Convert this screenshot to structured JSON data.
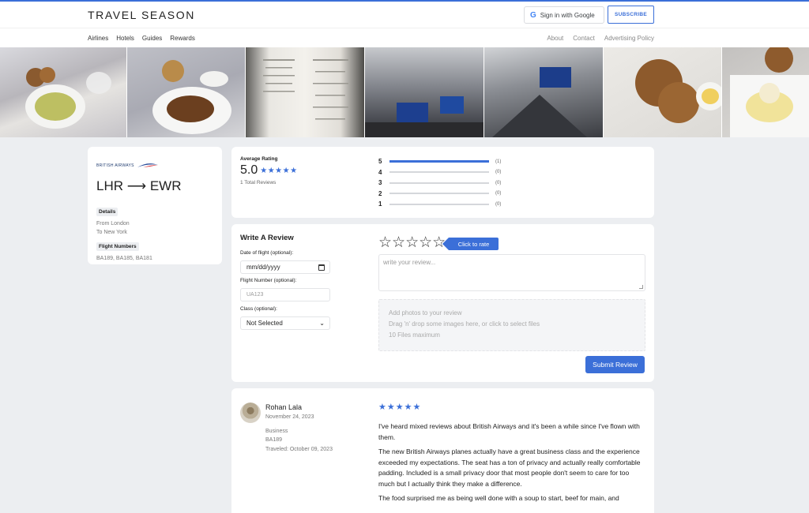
{
  "header": {
    "brand": "TRAVEL SEASON",
    "google_signin": "Sign in with Google",
    "subscribe": "SUBSCRIBE",
    "nav_left": [
      "Airlines",
      "Hotels",
      "Guides",
      "Rewards"
    ],
    "nav_right": [
      "About",
      "Contact",
      "Advertising Policy"
    ]
  },
  "airline": {
    "logo_text": "BRITISH AIRWAYS",
    "route": "LHR ⟶ EWR",
    "details_label": "Details",
    "from": "From London",
    "to": "To New York",
    "flight_numbers_label": "Flight Numbers",
    "flight_numbers": "BA189, BA185, BA181"
  },
  "rating": {
    "label": "Average Rating",
    "value": "5.0",
    "stars": "★★★★★",
    "total": "1 Total Reviews",
    "breakdown": [
      {
        "stars": "5",
        "count": "(1)",
        "fraction": 1.0
      },
      {
        "stars": "4",
        "count": "(0)",
        "fraction": 0
      },
      {
        "stars": "3",
        "count": "(0)",
        "fraction": 0
      },
      {
        "stars": "2",
        "count": "(0)",
        "fraction": 0
      },
      {
        "stars": "1",
        "count": "(0)",
        "fraction": 0
      }
    ]
  },
  "write_review": {
    "title": "Write A Review",
    "date_label": "Date of flight (optional):",
    "date_value": "mm/dd/yyyy",
    "flight_label": "Flight Number (optional):",
    "flight_placeholder": "UA123",
    "class_label": "Class (optional):",
    "class_value": "Not Selected",
    "empty_stars": "☆☆☆☆☆",
    "click_to_rate": "Click to rate",
    "review_placeholder": "write your review...",
    "photos_title": "Add photos to your review",
    "photos_hint": "Drag 'n' drop some images here, or click to select files",
    "photos_max": "10 Files maximum",
    "submit": "Submit Review"
  },
  "review": {
    "name": "Rohan Lala",
    "date": "November 24, 2023",
    "class": "Business",
    "flight": "BA189",
    "traveled": "Traveled: October 09, 2023",
    "stars": "★★★★★",
    "paragraphs": [
      "I've heard mixed reviews about British Airways and it's been a while since I've flown with them.",
      "The new British Airways planes actually have a great business class and the experience exceeded my expectations. The seat has a ton of privacy and actually really comfortable padding. Included is a small privacy door that most people don't seem to care for too much but I actually think they make a difference.",
      "The food surprised me as being well done with a soup to start, beef for main, and"
    ]
  },
  "colors": {
    "accent": "#3b6fd8",
    "background": "#eceef1"
  }
}
